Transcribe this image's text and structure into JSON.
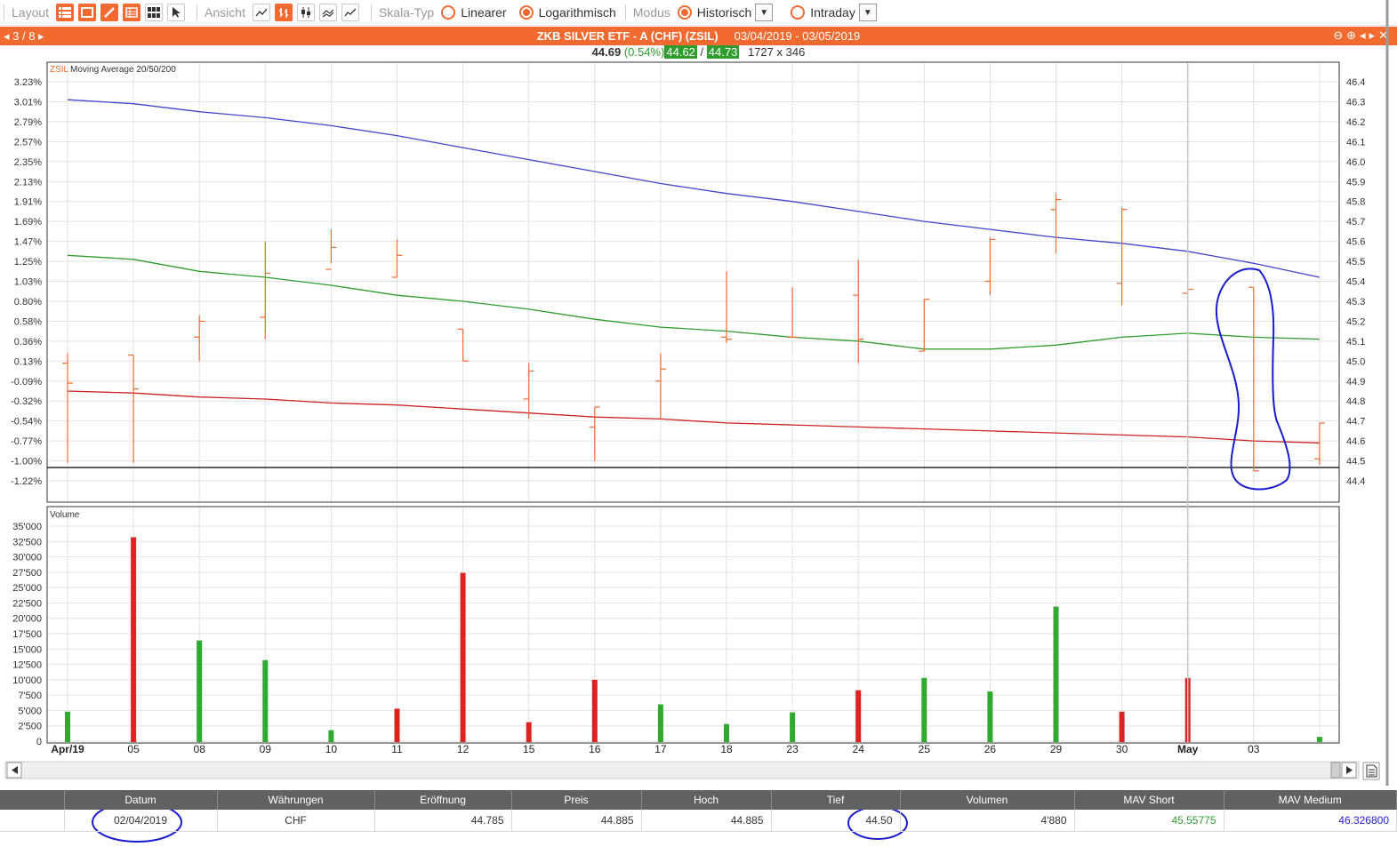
{
  "toolbar": {
    "layout_label": "Layout",
    "ansicht_label": "Ansicht",
    "skala_label": "Skala-Typ",
    "scale_linear": "Linearer",
    "scale_log": "Logarithmisch",
    "modus_label": "Modus",
    "mode_hist": "Historisch",
    "mode_intraday": "Intraday"
  },
  "titlebar": {
    "nav": "3 / 8",
    "title": "ZKB SILVER ETF - A (CHF) (ZSIL)",
    "dates": "03/04/2019 - 03/05/2019"
  },
  "quote": {
    "price": "44.69",
    "change": "(0.54%)",
    "bid": "44.62",
    "sep": "/",
    "ask": "44.73",
    "size": "1727 x 346"
  },
  "colors": {
    "accent": "#f26a30",
    "ma_short": "#cc2222",
    "ma_medium": "#2e9d2e",
    "ma_long": "#4444cc",
    "bar_up": "#2eaa2e",
    "bar_down": "#dd2222",
    "annotation": "#1a1ad0"
  },
  "chart_data": [
    {
      "type": "line",
      "panel_label": "ZSIL",
      "panel_title": "Moving Average 20/50/200",
      "x": [
        "Apr/19",
        "05",
        "08",
        "09",
        "10",
        "11",
        "12",
        "15",
        "16",
        "17",
        "18",
        "23",
        "24",
        "25",
        "26",
        "29",
        "30",
        "May",
        "03",
        ""
      ],
      "left_ticks": [
        "3.23%",
        "3.01%",
        "2.79%",
        "2.57%",
        "2.35%",
        "2.13%",
        "1.91%",
        "1.69%",
        "1.47%",
        "1.25%",
        "1.03%",
        "0.80%",
        "0.58%",
        "0.36%",
        "0.13%",
        "-0.09%",
        "-0.32%",
        "-0.54%",
        "-0.77%",
        "-1.00%",
        "-1.22%"
      ],
      "right_ticks": [
        "46.4",
        "46.3",
        "46.2",
        "46.1",
        "46.0",
        "45.9",
        "45.8",
        "45.7",
        "45.6",
        "45.5",
        "45.4",
        "45.3",
        "45.2",
        "45.1",
        "45.0",
        "44.9",
        "44.8",
        "44.7",
        "44.6",
        "44.5",
        "44.4"
      ],
      "ylim": [
        44.4,
        46.4
      ],
      "scale": "log",
      "grid": true,
      "ohlc": [
        {
          "o": 44.99,
          "h": 45.04,
          "l": 44.49,
          "c": 44.89
        },
        {
          "o": 45.03,
          "h": 45.03,
          "l": 44.49,
          "c": 44.86
        },
        {
          "o": 45.12,
          "h": 45.23,
          "l": 45.0,
          "c": 45.2
        },
        {
          "o": 45.22,
          "h": 45.6,
          "l": 45.11,
          "c": 45.44
        },
        {
          "o": 45.46,
          "h": 45.66,
          "l": 45.49,
          "c": 45.57
        },
        {
          "o": 45.42,
          "h": 45.61,
          "l": 45.42,
          "c": 45.53
        },
        {
          "o": 45.16,
          "h": 45.16,
          "l": 45.0,
          "c": 45.0
        },
        {
          "o": 44.81,
          "h": 44.99,
          "l": 44.71,
          "c": 44.95
        },
        {
          "o": 44.67,
          "h": 44.77,
          "l": 44.5,
          "c": 44.77
        },
        {
          "o": 44.9,
          "h": 45.04,
          "l": 44.71,
          "c": 44.96
        },
        {
          "o": 45.12,
          "h": 45.45,
          "l": 45.09,
          "c": 45.11
        },
        {
          "o": 45.12,
          "h": 45.37,
          "l": 45.12,
          "c": 45.12
        },
        {
          "o": 45.33,
          "h": 45.51,
          "l": 44.99,
          "c": 45.11
        },
        {
          "o": 45.05,
          "h": 45.31,
          "l": 45.05,
          "c": 45.31
        },
        {
          "o": 45.4,
          "h": 45.62,
          "l": 45.33,
          "c": 45.61
        },
        {
          "o": 45.76,
          "h": 45.84,
          "l": 45.54,
          "c": 45.81
        },
        {
          "o": 45.39,
          "h": 45.77,
          "l": 45.28,
          "c": 45.76
        },
        {
          "o": 45.34,
          "h": 45.62,
          "l": 45.16,
          "c": 45.36
        },
        {
          "o": 45.37,
          "h": 45.37,
          "l": 44.45,
          "c": 44.45
        },
        {
          "o": 44.51,
          "h": 44.69,
          "l": 44.48,
          "c": 44.69
        }
      ],
      "series": [
        {
          "values": [
            46.31,
            46.29,
            46.25,
            46.22,
            46.18,
            46.13,
            46.07,
            46.01,
            45.95,
            45.89,
            45.84,
            45.8,
            45.75,
            45.7,
            45.66,
            45.62,
            45.59,
            45.55,
            45.49,
            45.42
          ]
        },
        {
          "values": [
            45.53,
            45.51,
            45.45,
            45.42,
            45.38,
            45.33,
            45.3,
            45.26,
            45.21,
            45.17,
            45.15,
            45.12,
            45.1,
            45.06,
            45.06,
            45.08,
            45.12,
            45.14,
            45.12,
            45.11
          ]
        },
        {
          "values": [
            44.85,
            44.84,
            44.82,
            44.81,
            44.79,
            44.78,
            44.76,
            44.74,
            44.72,
            44.71,
            44.69,
            44.68,
            44.67,
            44.66,
            44.65,
            44.64,
            44.63,
            44.62,
            44.6,
            44.59
          ]
        }
      ]
    },
    {
      "type": "bar",
      "panel_title": "Volume",
      "categories": [
        "Apr/19",
        "05",
        "08",
        "09",
        "10",
        "11",
        "12",
        "15",
        "16",
        "17",
        "18",
        "23",
        "24",
        "25",
        "26",
        "29",
        "30",
        "May",
        "03",
        ""
      ],
      "values": [
        4800,
        33200,
        16400,
        13200,
        1800,
        5300,
        27400,
        3100,
        10000,
        6000,
        2800,
        4700,
        8300,
        10300,
        8100,
        21900,
        4800,
        10300,
        0,
        700
      ],
      "direction": [
        "up",
        "down",
        "up",
        "up",
        "up",
        "down",
        "down",
        "down",
        "down",
        "up",
        "up",
        "up",
        "down",
        "up",
        "up",
        "up",
        "down",
        "down",
        "up",
        "up"
      ],
      "yticks": [
        "35'000",
        "32'500",
        "30'000",
        "27'500",
        "25'000",
        "22'500",
        "20'000",
        "17'500",
        "15'000",
        "12'500",
        "10'000",
        "7'500",
        "5'000",
        "2'500",
        "0"
      ],
      "ylim": [
        0,
        35000
      ],
      "grid": true
    }
  ],
  "table": {
    "headers": [
      "Datum",
      "Währungen",
      "Eröffnung",
      "Preis",
      "Hoch",
      "Tief",
      "Volumen",
      "MAV Short",
      "MAV Medium"
    ],
    "row": [
      "02/04/2019",
      "CHF",
      "44.785",
      "44.885",
      "44.885",
      "44.50",
      "4'880",
      "45.55775",
      "46.326800"
    ]
  }
}
